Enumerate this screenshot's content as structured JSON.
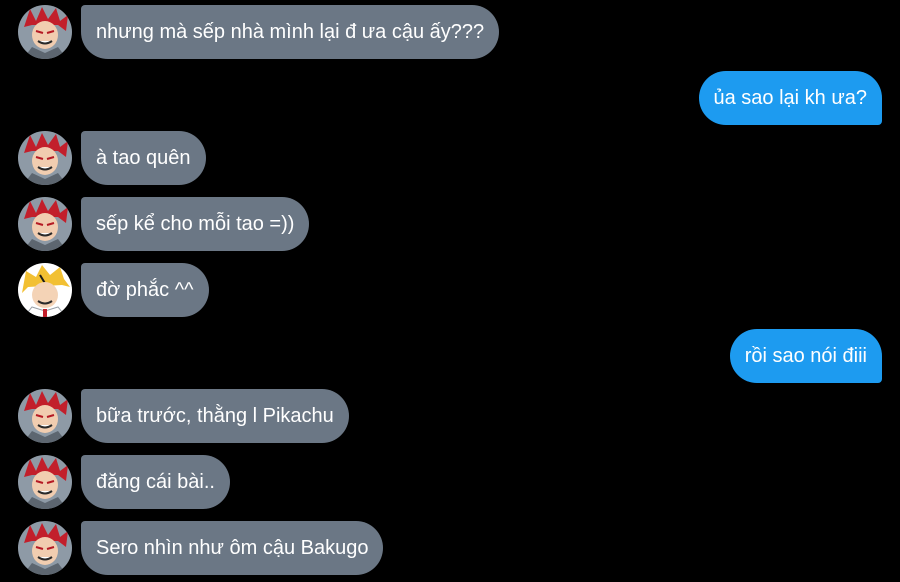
{
  "messages": [
    {
      "sender": "kirishima",
      "direction": "incoming",
      "avatar": "kirishima-avatar-icon",
      "text": "nhưng mà sếp nhà mình lại đ ưa cậu ấy???"
    },
    {
      "sender": "me",
      "direction": "outgoing",
      "text": "ủa sao lại kh ưa?"
    },
    {
      "sender": "kirishima",
      "direction": "incoming",
      "avatar": "kirishima-avatar-icon",
      "text": "à tao quên"
    },
    {
      "sender": "kirishima",
      "direction": "incoming",
      "avatar": "kirishima-avatar-icon",
      "text": "sếp kể cho mỗi tao =))"
    },
    {
      "sender": "kaminari",
      "direction": "incoming",
      "avatar": "kaminari-avatar-icon",
      "text": "đờ phắc ^^"
    },
    {
      "sender": "me",
      "direction": "outgoing",
      "text": "rồi sao nói điii"
    },
    {
      "sender": "kirishima",
      "direction": "incoming",
      "avatar": "kirishima-avatar-icon",
      "text": "bữa trước, thằng l Pikachu"
    },
    {
      "sender": "kirishima",
      "direction": "incoming",
      "avatar": "kirishima-avatar-icon",
      "text": "đăng cái bài.."
    },
    {
      "sender": "kirishima",
      "direction": "incoming",
      "avatar": "kirishima-avatar-icon",
      "text": "Sero nhìn như ôm cậu Bakugo"
    }
  ],
  "colors": {
    "background": "#000000",
    "incoming_bubble": "#6b7785",
    "outgoing_bubble": "#1d9bf0",
    "text": "#ffffff"
  }
}
